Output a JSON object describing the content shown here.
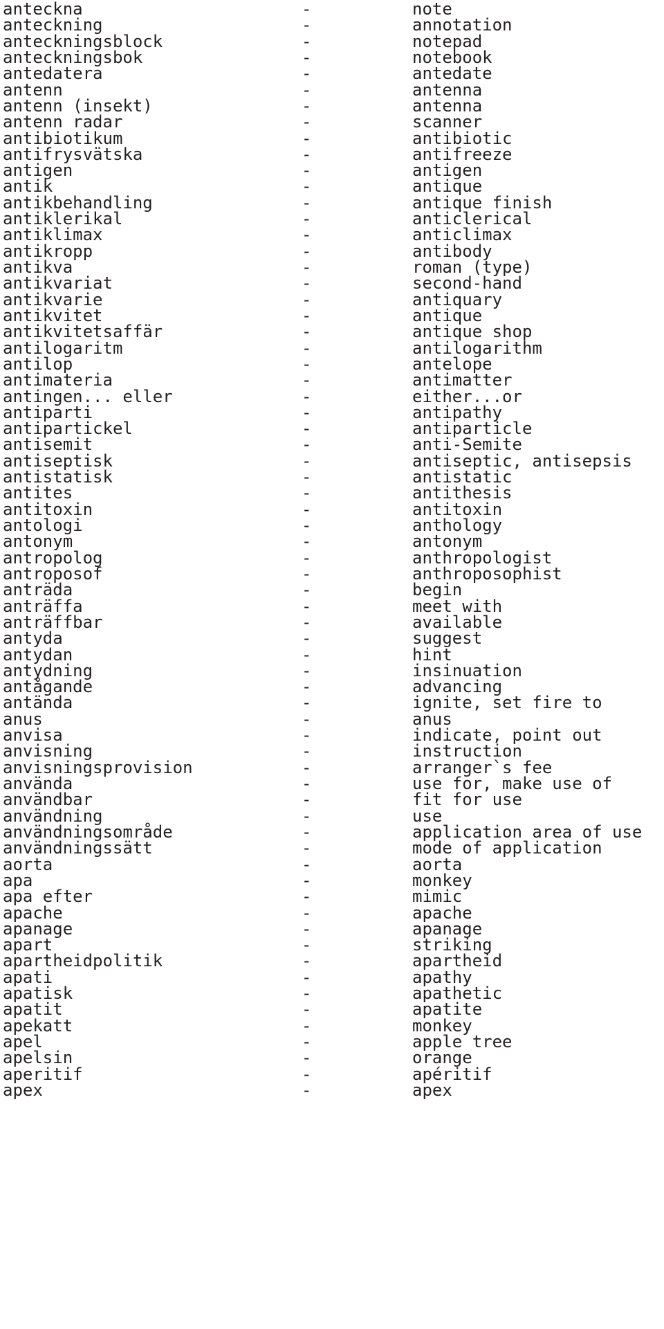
{
  "page": {
    "kind": "bilingual-dictionary-listing",
    "source_language": "Swedish",
    "target_language": "English",
    "separator": "-",
    "text_color": "#231f20",
    "background_color": "#ffffff"
  },
  "entries": [
    {
      "term": "anteckna",
      "sep": "-",
      "gloss": "note"
    },
    {
      "term": "anteckning",
      "sep": "-",
      "gloss": "annotation"
    },
    {
      "term": "anteckningsblock",
      "sep": "-",
      "gloss": "notepad"
    },
    {
      "term": "anteckningsbok",
      "sep": "-",
      "gloss": "notebook"
    },
    {
      "term": "antedatera",
      "sep": "-",
      "gloss": "antedate"
    },
    {
      "term": "antenn",
      "sep": "-",
      "gloss": "antenna"
    },
    {
      "term": "antenn (insekt)",
      "sep": "-",
      "gloss": "antenna"
    },
    {
      "term": "antenn radar",
      "sep": "-",
      "gloss": "scanner"
    },
    {
      "term": "antibiotikum",
      "sep": "-",
      "gloss": "antibiotic"
    },
    {
      "term": "antifrysvätska",
      "sep": "-",
      "gloss": "antifreeze"
    },
    {
      "term": "antigen",
      "sep": "-",
      "gloss": "antigen"
    },
    {
      "term": "antik",
      "sep": "-",
      "gloss": "antique"
    },
    {
      "term": "antikbehandling",
      "sep": "-",
      "gloss": "antique finish"
    },
    {
      "term": "antiklerikal",
      "sep": "-",
      "gloss": "anticlerical"
    },
    {
      "term": "antiklimax",
      "sep": "-",
      "gloss": "anticlimax"
    },
    {
      "term": "antikropp",
      "sep": "-",
      "gloss": "antibody"
    },
    {
      "term": "antikva",
      "sep": "-",
      "gloss": "roman (type)"
    },
    {
      "term": "antikvariat",
      "sep": "-",
      "gloss": "second-hand"
    },
    {
      "term": "antikvarie",
      "sep": "-",
      "gloss": "antiquary"
    },
    {
      "term": "antikvitet",
      "sep": "-",
      "gloss": "antique"
    },
    {
      "term": "antikvitetsaffär",
      "sep": "-",
      "gloss": "antique shop"
    },
    {
      "term": "antilogaritm",
      "sep": "-",
      "gloss": "antilogarithm"
    },
    {
      "term": "antilop",
      "sep": "-",
      "gloss": "antelope"
    },
    {
      "term": "antimateria",
      "sep": "-",
      "gloss": "antimatter"
    },
    {
      "term": "antingen... eller",
      "sep": "-",
      "gloss": "either...or"
    },
    {
      "term": "antiparti",
      "sep": "-",
      "gloss": "antipathy"
    },
    {
      "term": "antipartickel",
      "sep": "-",
      "gloss": "antiparticle"
    },
    {
      "term": "antisemit",
      "sep": "-",
      "gloss": "anti-Semite"
    },
    {
      "term": "antiseptisk",
      "sep": "-",
      "gloss": "antiseptic, antisepsis"
    },
    {
      "term": "antistatisk",
      "sep": "-",
      "gloss": "antistatic"
    },
    {
      "term": "antites",
      "sep": "-",
      "gloss": "antithesis"
    },
    {
      "term": "antitoxin",
      "sep": "-",
      "gloss": "antitoxin"
    },
    {
      "term": "antologi",
      "sep": "-",
      "gloss": "anthology"
    },
    {
      "term": "antonym",
      "sep": "-",
      "gloss": "antonym"
    },
    {
      "term": "antropolog",
      "sep": "-",
      "gloss": "anthropologist"
    },
    {
      "term": "antroposof",
      "sep": "-",
      "gloss": "anthroposophist"
    },
    {
      "term": "anträda",
      "sep": "-",
      "gloss": "begin"
    },
    {
      "term": "anträffa",
      "sep": "-",
      "gloss": "meet with"
    },
    {
      "term": "anträffbar",
      "sep": "-",
      "gloss": "available"
    },
    {
      "term": "antyda",
      "sep": "-",
      "gloss": "suggest"
    },
    {
      "term": "antydan",
      "sep": "-",
      "gloss": "hint"
    },
    {
      "term": "antydning",
      "sep": "-",
      "gloss": "insinuation"
    },
    {
      "term": "antågande",
      "sep": "-",
      "gloss": "advancing"
    },
    {
      "term": "antända",
      "sep": "-",
      "gloss": "ignite, set fire to"
    },
    {
      "term": "anus",
      "sep": "-",
      "gloss": "anus"
    },
    {
      "term": "anvisa",
      "sep": "-",
      "gloss": "indicate, point out"
    },
    {
      "term": "anvisning",
      "sep": "-",
      "gloss": "instruction"
    },
    {
      "term": "anvisningsprovision",
      "sep": "-",
      "gloss": "arranger`s fee"
    },
    {
      "term": "använda",
      "sep": "-",
      "gloss": "use for, make use of"
    },
    {
      "term": "användbar",
      "sep": "-",
      "gloss": "fit for use"
    },
    {
      "term": "användning",
      "sep": "-",
      "gloss": "use"
    },
    {
      "term": "användningsområde",
      "sep": "-",
      "gloss": "application area of use"
    },
    {
      "term": "användningssätt",
      "sep": "-",
      "gloss": "mode of application"
    },
    {
      "term": "aorta",
      "sep": "-",
      "gloss": "aorta"
    },
    {
      "term": "apa",
      "sep": "-",
      "gloss": "monkey"
    },
    {
      "term": "apa efter",
      "sep": "-",
      "gloss": "mimic"
    },
    {
      "term": "apache",
      "sep": "-",
      "gloss": "apache"
    },
    {
      "term": "apanage",
      "sep": "-",
      "gloss": "apanage"
    },
    {
      "term": "apart",
      "sep": "-",
      "gloss": "striking"
    },
    {
      "term": "apartheidpolitik",
      "sep": "-",
      "gloss": "apartheid"
    },
    {
      "term": "apati",
      "sep": "-",
      "gloss": "apathy"
    },
    {
      "term": "apatisk",
      "sep": "-",
      "gloss": "apathetic"
    },
    {
      "term": "apatit",
      "sep": "-",
      "gloss": "apatite"
    },
    {
      "term": "apekatt",
      "sep": "-",
      "gloss": "monkey"
    },
    {
      "term": "apel",
      "sep": "-",
      "gloss": "apple tree"
    },
    {
      "term": "apelsin",
      "sep": "-",
      "gloss": "orange"
    },
    {
      "term": "aperitif",
      "sep": "-",
      "gloss": "apéritif"
    },
    {
      "term": "apex",
      "sep": "-",
      "gloss": "apex"
    }
  ]
}
